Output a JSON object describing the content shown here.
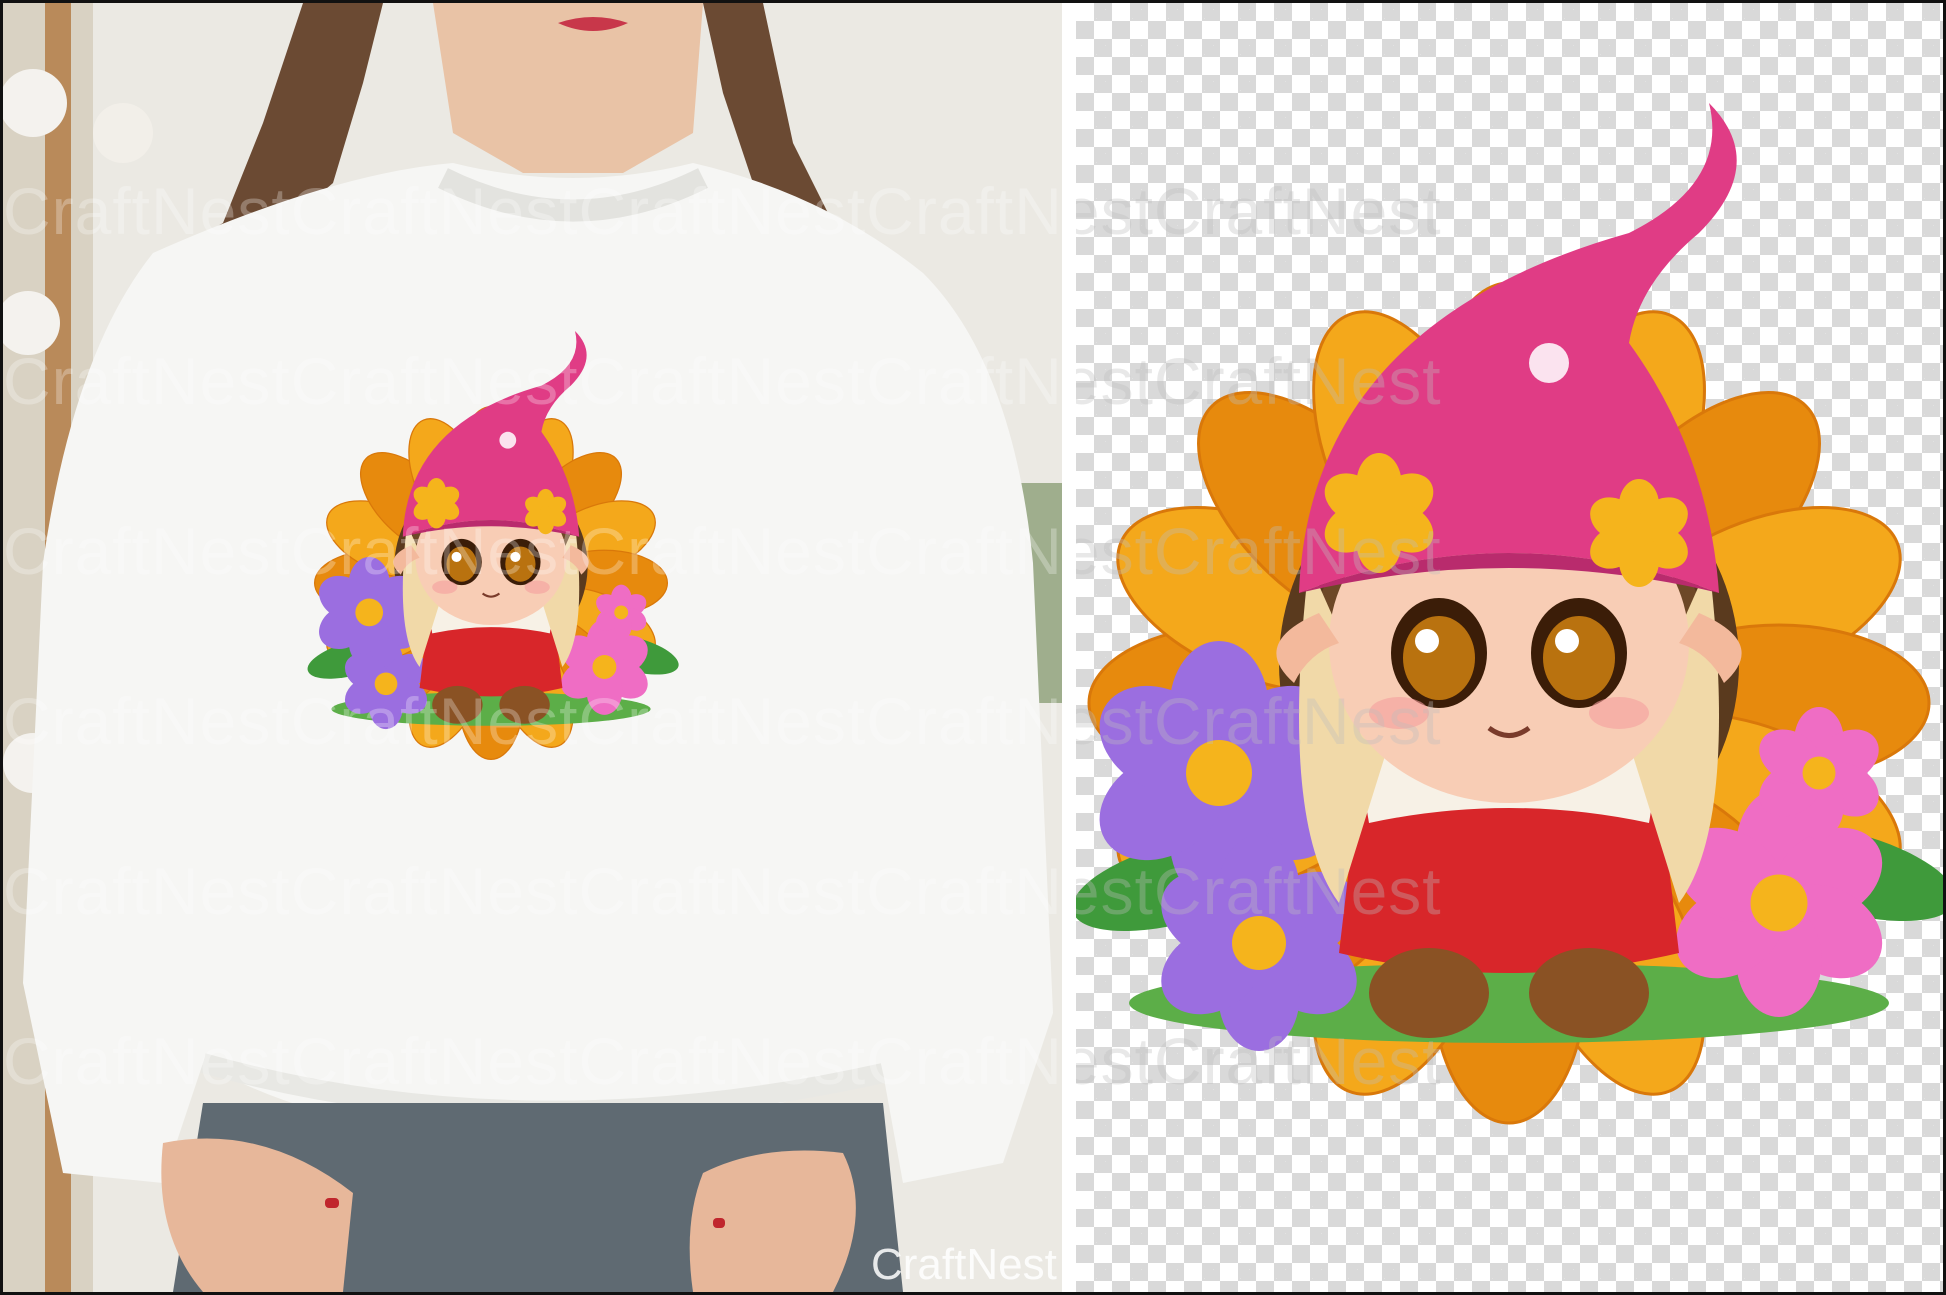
{
  "watermark": {
    "text": "CraftNestCraftNestCraftNestCraftNestCraftNest",
    "corner_text": "CraftNest"
  },
  "colors": {
    "sweater": "#f6f6f4",
    "petal": "#f4a81b",
    "petal_dark": "#e78a0d",
    "sunflower_center": "#5a3a1e",
    "hat": "#e03c85",
    "hair": "#f1d9a8",
    "overalls": "#d8262a",
    "flower_purple": "#9b6ee0",
    "flower_pink": "#ef6dc4",
    "leaf": "#3f9a3b"
  }
}
